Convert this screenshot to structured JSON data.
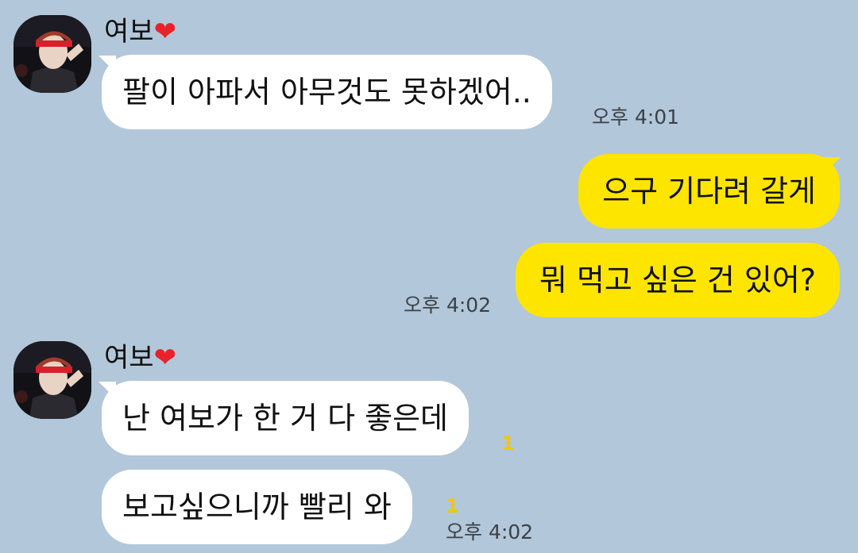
{
  "chat": {
    "groups": [
      {
        "sender": "여보",
        "sender_heart": "❤",
        "messages": [
          {
            "text": "팔이 아파서 아무것도 못하겠어..",
            "time": "오후 4:01",
            "unread": ""
          }
        ]
      },
      {
        "sender": "me",
        "messages": [
          {
            "text": "으구 기다려 갈게",
            "time": "",
            "unread": ""
          },
          {
            "text": "뭐 먹고 싶은 건 있어?",
            "time": "오후 4:02",
            "unread": ""
          }
        ]
      },
      {
        "sender": "여보",
        "sender_heart": "❤",
        "messages": [
          {
            "text": "난 여보가 한 거 다 좋은데",
            "time": "",
            "unread": "1"
          },
          {
            "text": "보고싶으니까 빨리 와",
            "time": "오후 4:02",
            "unread": "1"
          }
        ]
      }
    ]
  },
  "colors": {
    "background": "#b2c7d9",
    "incoming_bubble": "#ffffff",
    "outgoing_bubble": "#fee500",
    "unread_count": "#f0c800",
    "heart": "#e8222a"
  },
  "icons": {
    "heart": "heart-icon",
    "avatar": "profile-photo"
  }
}
